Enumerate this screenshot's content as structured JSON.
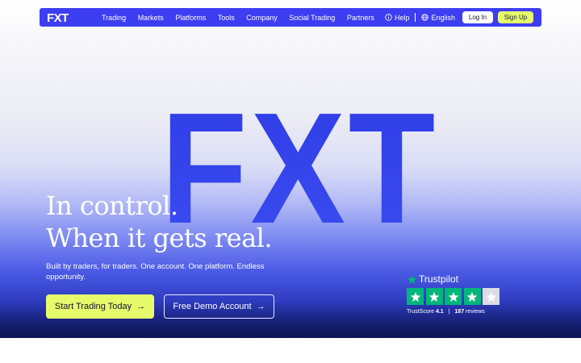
{
  "nav": {
    "logo": "FXT",
    "links": [
      "Trading",
      "Markets",
      "Platforms",
      "Tools",
      "Company",
      "Social Trading",
      "Partners"
    ],
    "help": "Help",
    "language": "English",
    "login": "Log In",
    "signup": "Sign Up"
  },
  "hero": {
    "brand_mark": "FXT",
    "headline_line1": "In control.",
    "headline_line2": "When it gets real.",
    "subtitle": "Built by traders, for traders. One account. One platform. Endless opportunity.",
    "cta_primary": "Start Trading Today",
    "cta_secondary": "Free Demo Account",
    "arrow": "→"
  },
  "trustpilot": {
    "brand": "Trustpilot",
    "score_label": "TrustScore",
    "score": "4.1",
    "separator": "|",
    "reviews_count": "187",
    "reviews_label": "reviews",
    "stars_filled": 4,
    "stars_total": 5
  },
  "colors": {
    "nav_bg": "#3d3df2",
    "accent_lime": "#e6fb6a",
    "trustpilot_green": "#00b67a",
    "star_empty": "#dcdce6"
  }
}
